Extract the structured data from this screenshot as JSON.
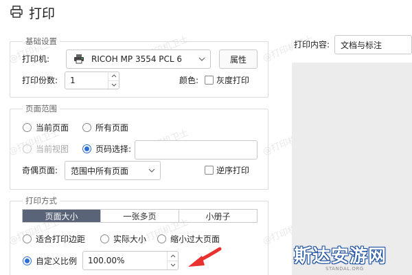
{
  "window": {
    "title": "打印"
  },
  "basic": {
    "group_label": "基础设置",
    "printer_label": "打印机:",
    "printer_value": "RICOH MP 3554 PCL 6",
    "properties_button": "属性",
    "copies_label": "打印份数:",
    "copies_value": "1",
    "color_label": "颜色:",
    "grayscale_label": "灰度打印",
    "grayscale_checked": false
  },
  "page_range": {
    "group_label": "页面范围",
    "current_page": "当前页面",
    "all_pages": "所有页面",
    "current_view": "当前视图",
    "page_select": "页码选择:",
    "page_select_value": "",
    "selected": "page_select",
    "odd_even_label": "奇偶页面:",
    "odd_even_value": "范围中所有页面",
    "reverse_label": "逆序打印",
    "reverse_checked": false
  },
  "print_mode": {
    "group_label": "打印方式",
    "tabs": [
      "页面大小",
      "一张多页",
      "小册子"
    ],
    "active_tab": 0,
    "fit_margins": "适合打印边距",
    "actual_size": "实际大小",
    "shrink_oversized": "缩小过大页面",
    "custom_scale": "自定义比例",
    "custom_scale_value": "100.00%",
    "selected": "custom_scale"
  },
  "preview": {
    "content_label": "打印内容:",
    "content_value": "文档与标注"
  },
  "watermark": {
    "text": "@打印机卫士"
  },
  "brand": {
    "name": "斯达安游网",
    "domain": "STANDAL.ORG"
  },
  "colors": {
    "accent": "#2b6fd6",
    "tab_active": "#5a6478",
    "arrow": "#e8322f"
  }
}
